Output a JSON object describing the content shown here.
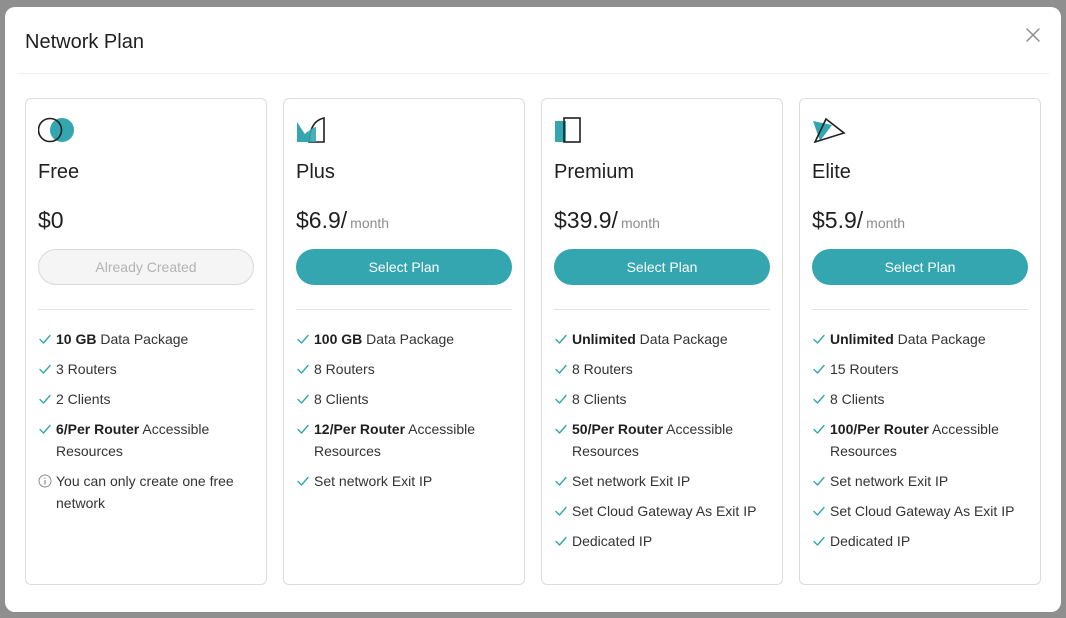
{
  "modal": {
    "title": "Network Plan"
  },
  "colors": {
    "accent": "#33a6b0",
    "check": "#33a6b0",
    "muted": "#8c8c8c"
  },
  "plans": [
    {
      "icon": "circles-icon",
      "name": "Free",
      "price": "$0",
      "per": "",
      "button": "Already Created",
      "button_disabled": true,
      "features": [
        {
          "icon": "check-icon",
          "bold": "10 GB",
          "text": " Data Package"
        },
        {
          "icon": "check-icon",
          "bold": "",
          "text": "3 Routers"
        },
        {
          "icon": "check-icon",
          "bold": "",
          "text": "2 Clients"
        },
        {
          "icon": "check-icon",
          "bold": "6/Per Router",
          "text": " Accessible Resources"
        },
        {
          "icon": "info-icon",
          "bold": "",
          "text": "You can only create one free network"
        }
      ]
    },
    {
      "icon": "quarter-shape-icon",
      "name": "Plus",
      "price": "$6.9/",
      "per": "month",
      "button": "Select Plan",
      "button_disabled": false,
      "features": [
        {
          "icon": "check-icon",
          "bold": "100 GB",
          "text": " Data Package"
        },
        {
          "icon": "check-icon",
          "bold": "",
          "text": "8 Routers"
        },
        {
          "icon": "check-icon",
          "bold": "",
          "text": "8 Clients"
        },
        {
          "icon": "check-icon",
          "bold": "12/Per Router",
          "text": " Accessible Resources"
        },
        {
          "icon": "check-icon",
          "bold": "",
          "text": "Set network Exit IP"
        }
      ]
    },
    {
      "icon": "panel-icon",
      "name": "Premium",
      "price": "$39.9/",
      "per": "month",
      "button": "Select Plan",
      "button_disabled": false,
      "features": [
        {
          "icon": "check-icon",
          "bold": "Unlimited",
          "text": " Data Package"
        },
        {
          "icon": "check-icon",
          "bold": "",
          "text": "8 Routers"
        },
        {
          "icon": "check-icon",
          "bold": "",
          "text": "8 Clients"
        },
        {
          "icon": "check-icon",
          "bold": "50/Per Router",
          "text": " Accessible Resources"
        },
        {
          "icon": "check-icon",
          "bold": "",
          "text": "Set network Exit IP"
        },
        {
          "icon": "check-icon",
          "bold": "",
          "text": "Set Cloud Gateway As Exit IP"
        },
        {
          "icon": "check-icon",
          "bold": "",
          "text": "Dedicated IP"
        }
      ]
    },
    {
      "icon": "triangle-icon",
      "name": "Elite",
      "price": "$5.9/",
      "per": "month",
      "button": "Select Plan",
      "button_disabled": false,
      "features": [
        {
          "icon": "check-icon",
          "bold": "Unlimited",
          "text": " Data Package"
        },
        {
          "icon": "check-icon",
          "bold": "",
          "text": "15 Routers"
        },
        {
          "icon": "check-icon",
          "bold": "",
          "text": "8 Clients"
        },
        {
          "icon": "check-icon",
          "bold": "100/Per Router",
          "text": " Accessible Resources"
        },
        {
          "icon": "check-icon",
          "bold": "",
          "text": "Set network Exit IP"
        },
        {
          "icon": "check-icon",
          "bold": "",
          "text": "Set Cloud Gateway As Exit IP"
        },
        {
          "icon": "check-icon",
          "bold": "",
          "text": "Dedicated IP"
        }
      ]
    }
  ]
}
